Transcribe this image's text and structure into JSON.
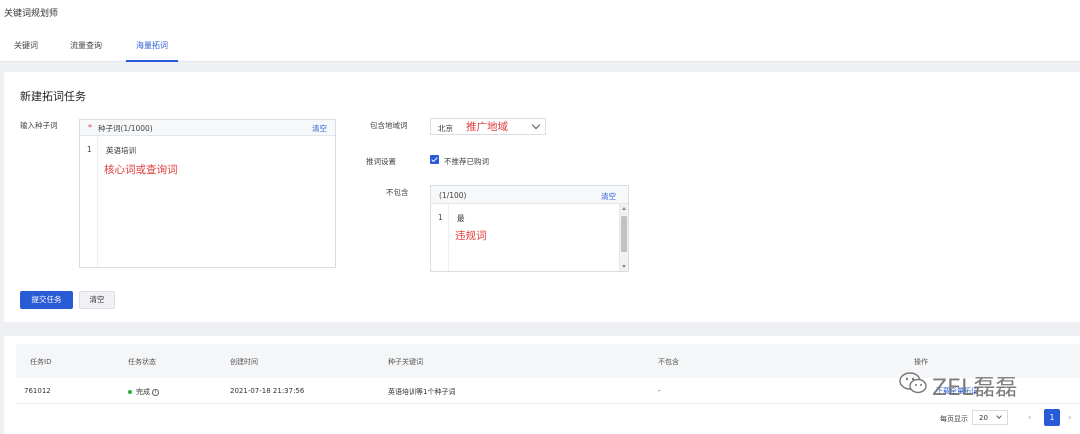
{
  "app": {
    "title": "关键词规划师"
  },
  "tabs": [
    {
      "label": "关键词"
    },
    {
      "label": "流量查询"
    },
    {
      "label": "海量拓词",
      "active": true
    }
  ],
  "form": {
    "title": "新建拓词任务",
    "seed": {
      "label": "输入种子词",
      "header": "种子词(1/1000)",
      "required_mark": "*",
      "clear": "清空",
      "lines": [
        {
          "no": "1",
          "text": "英语培训"
        }
      ],
      "annotation": "核心词或查询词"
    },
    "region": {
      "label": "包含地域词",
      "value": "北京",
      "annotation": "推广地域"
    },
    "recommend": {
      "label": "推词设置",
      "checkbox_label": "不推荐已购词",
      "checked": true
    },
    "exclude": {
      "label": "不包含",
      "header": "(1/100)",
      "clear": "清空",
      "lines": [
        {
          "no": "1",
          "text": "最"
        }
      ],
      "annotation": "违规词"
    },
    "submit_label": "提交任务",
    "clear_label": "清空"
  },
  "table": {
    "columns": [
      "任务ID",
      "任务状态",
      "创建时间",
      "种子关键词",
      "不包含",
      "操作"
    ],
    "rows": [
      {
        "id": "761012",
        "status": "完成",
        "created": "2021-07-18 21:37:56",
        "seed": "英语培训等1个种子词",
        "exclude": "-",
        "action": "下载全量拓词"
      }
    ]
  },
  "pagination": {
    "per_page_label": "每页显示",
    "per_page": "20",
    "prev": "‹",
    "next": "›",
    "current_page": "1"
  },
  "watermark": {
    "text": "ZEL磊磊"
  },
  "colors": {
    "primary": "#2a5bd7",
    "annotation": "#e03c3c",
    "success": "#29a745"
  }
}
